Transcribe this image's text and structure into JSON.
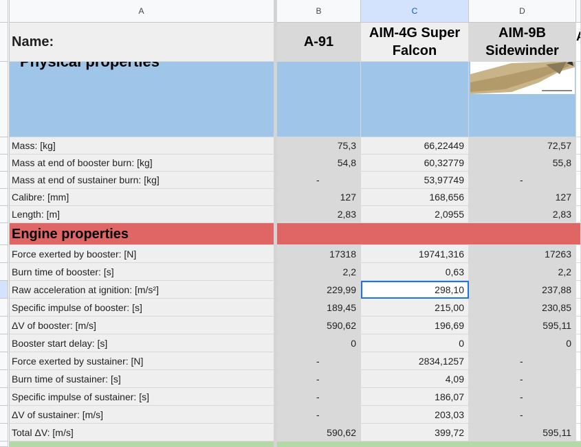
{
  "columns": {
    "a": "A",
    "b": "B",
    "c": "C",
    "d": "D"
  },
  "header": {
    "name_label": "Name:",
    "b": "A-91",
    "c_line1": "AIM-4G Super",
    "c_line2": "Falcon",
    "d_line1": "AIM-9B",
    "d_line2": "Sidewinder",
    "e_partial": "A"
  },
  "sections": {
    "physical": "Physical properties",
    "engine": "Engine properties"
  },
  "physical_rows": [
    {
      "label": "Mass: [kg]",
      "b": "75,3",
      "c": "66,22449",
      "d": "72,57"
    },
    {
      "label": "Mass at end of booster burn: [kg]",
      "b": "54,8",
      "c": "60,32779",
      "d": "55,8"
    },
    {
      "label": "Mass at end of sustainer burn: [kg]",
      "b": "-",
      "c": "53,97749",
      "d": "-"
    },
    {
      "label": "Calibre: [mm]",
      "b": "127",
      "c": "168,656",
      "d": "127"
    },
    {
      "label": "Length: [m]",
      "b": "2,83",
      "c": "2,0955",
      "d": "2,83"
    }
  ],
  "engine_rows": [
    {
      "label": "Force exerted by booster: [N]",
      "b": "17318",
      "c": "19741,316",
      "d": "17263"
    },
    {
      "label": "Burn time of booster: [s]",
      "b": "2,2",
      "c": "0,63",
      "d": "2,2"
    },
    {
      "label": "Raw acceleration at ignition: [m/s²]",
      "b": "229,99",
      "c": "298,10",
      "d": "237,88"
    },
    {
      "label": "Specific impulse of booster: [s]",
      "b": "189,45",
      "c": "215,00",
      "d": "230,85"
    },
    {
      "label": "ΔV of booster: [m/s]",
      "b": "590,62",
      "c": "196,69",
      "d": "595,11"
    },
    {
      "label": "Booster start delay: [s]",
      "b": "0",
      "c": "0",
      "d": "0"
    },
    {
      "label": "Force exerted by sustainer: [N]",
      "b": "-",
      "c": "2834,1257",
      "d": "-"
    },
    {
      "label": "Burn time of sustainer: [s]",
      "b": "-",
      "c": "4,09",
      "d": "-"
    },
    {
      "label": "Specific impulse of sustainer: [s]",
      "b": "-",
      "c": "186,07",
      "d": "-"
    },
    {
      "label": "ΔV of sustainer: [m/s]",
      "b": "-",
      "c": "203,03",
      "d": "-"
    },
    {
      "label": "Total ΔV: [m/s]",
      "b": "590,62",
      "c": "399,72",
      "d": "595,11"
    }
  ],
  "colors": {
    "section_blue": "#9fc5e8",
    "section_red": "#e06666",
    "section_green": "#b6d7a8",
    "selection": "#1a73e8"
  }
}
